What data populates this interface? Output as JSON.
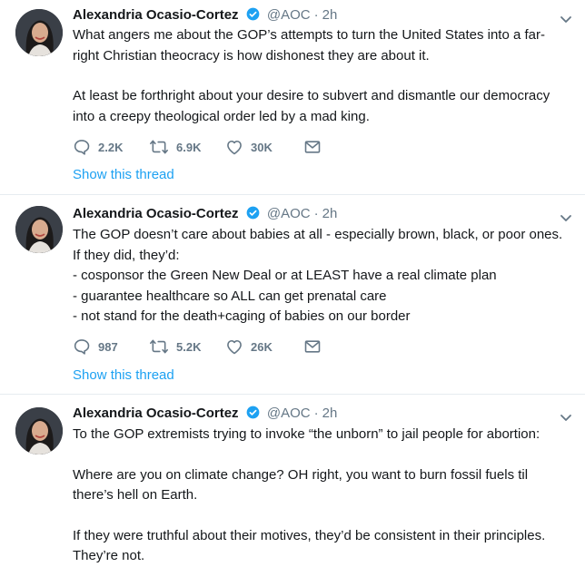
{
  "tweets": [
    {
      "author": "Alexandria Ocasio-Cortez",
      "handle": "@AOC",
      "separator": "·",
      "time": "2h",
      "lines": [
        "What angers me about the GOP’s attempts to turn the United States into a far-",
        "right Christian theocracy is how dishonest they are about it.",
        "",
        "At least be forthright about your desire to subvert and dismantle our democracy",
        "into a creepy theological order led by a mad king."
      ],
      "replies": "2.2K",
      "retweets": "6.9K",
      "likes": "30K",
      "show_thread": "Show this thread"
    },
    {
      "author": "Alexandria Ocasio-Cortez",
      "handle": "@AOC",
      "separator": "·",
      "time": "2h",
      "lines": [
        "The GOP doesn’t care about babies at all - especially brown, black, or poor ones.",
        "If they did, they’d:",
        "- cosponsor the Green New Deal or at LEAST have a real climate plan",
        "- guarantee healthcare so ALL can get prenatal care",
        "- not stand for the death+caging of babies on our border"
      ],
      "replies": "987",
      "retweets": "5.2K",
      "likes": "26K",
      "show_thread": "Show this thread"
    },
    {
      "author": "Alexandria Ocasio-Cortez",
      "handle": "@AOC",
      "separator": "·",
      "time": "2h",
      "lines": [
        "To the GOP extremists trying to invoke “the unborn” to jail people for abortion:",
        "",
        "Where are you on climate change? OH right, you want to burn fossil fuels til",
        "there’s hell on Earth.",
        "",
        "If they were truthful about their motives, they’d be consistent in their principles.",
        "They’re not."
      ]
    }
  ],
  "colors": {
    "accent": "#1da1f2",
    "muted": "#657786",
    "text": "#14171a",
    "divider": "#e6ecf0"
  },
  "icons": [
    "verified-badge-icon",
    "chevron-down-icon",
    "reply-icon",
    "retweet-icon",
    "like-icon",
    "message-icon"
  ]
}
